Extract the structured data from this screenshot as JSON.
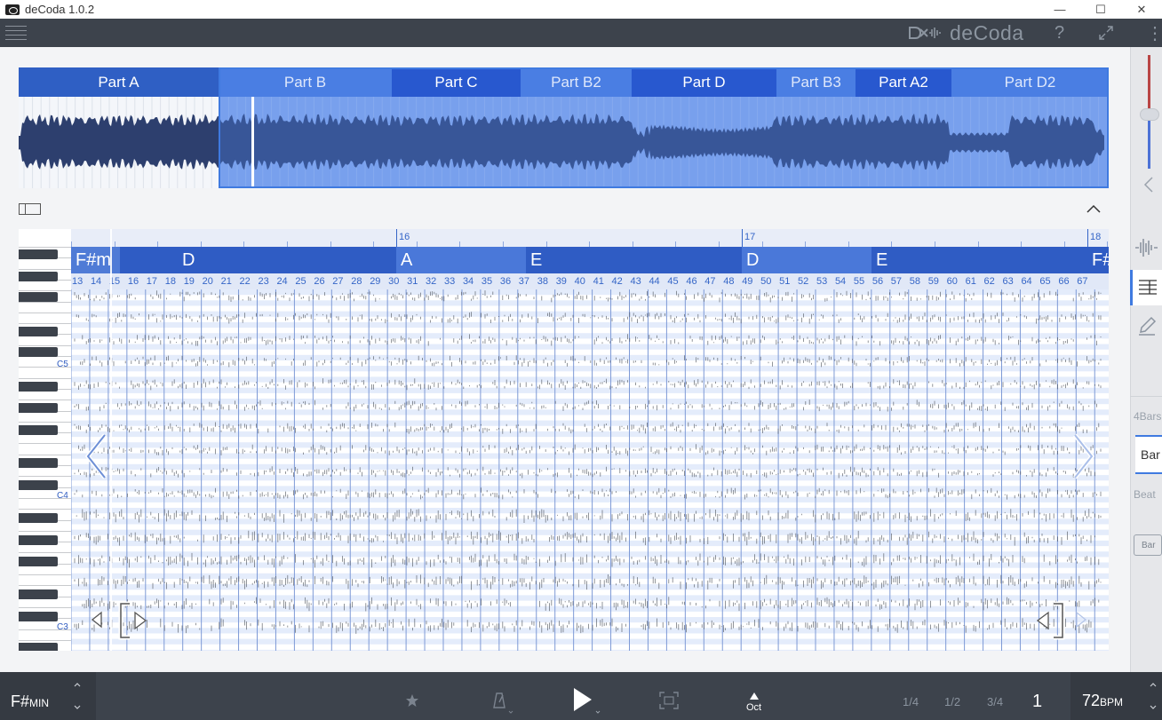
{
  "window": {
    "title": "deCoda 1.0.2",
    "minimize": "—",
    "maximize": "☐",
    "close": "✕"
  },
  "toolbar": {
    "brand": "deCoda",
    "help": "?",
    "more": "⋮"
  },
  "parts": [
    {
      "label": "Part A",
      "color": "#2f5fc4",
      "active": true
    },
    {
      "label": "Part B",
      "color": "#4a7ee3"
    },
    {
      "label": "Part C",
      "color": "#2858cf"
    },
    {
      "label": "Part B2",
      "color": "#4a7ee3"
    },
    {
      "label": "Part D",
      "color": "#2858cf"
    },
    {
      "label": "Part B3",
      "color": "#4a7ee3"
    },
    {
      "label": "Part A2",
      "color": "#2858cf"
    },
    {
      "label": "Part D2",
      "color": "#4a7ee3"
    }
  ],
  "ruler": {
    "bars": [
      "16",
      "17",
      "18"
    ]
  },
  "chords": [
    "F#m",
    "D",
    "A",
    "E",
    "D",
    "E",
    "F#"
  ],
  "beats": [
    "13",
    "14",
    "15",
    "16",
    "17",
    "18",
    "19",
    "20",
    "21",
    "22",
    "23",
    "24",
    "25",
    "26",
    "27",
    "28",
    "29",
    "30",
    "31",
    "32",
    "33",
    "34",
    "35",
    "36",
    "37",
    "38",
    "39",
    "40",
    "41",
    "42",
    "43",
    "44",
    "45",
    "46",
    "47",
    "48",
    "49",
    "50",
    "51",
    "52",
    "53",
    "54",
    "55",
    "56",
    "57",
    "58",
    "59",
    "60",
    "61",
    "62",
    "63",
    "64",
    "65",
    "66",
    "67"
  ],
  "piano": {
    "labels": [
      "C5",
      "C4",
      "C3"
    ]
  },
  "zoom": {
    "options": [
      "4Bars",
      "Bar",
      "Beat"
    ],
    "selected": "Bar",
    "loop_label": "Bar"
  },
  "bottom": {
    "key": "F#",
    "mode": "MIN",
    "octave": "Oct",
    "fractions": [
      "1/4",
      "1/2",
      "3/4"
    ],
    "bar_position": "1",
    "bpm": "72",
    "bpm_unit": "BPM"
  },
  "colors": {
    "accent": "#3f7ae0",
    "dark": "#3d434c",
    "roll_light": "#e6edfb"
  }
}
